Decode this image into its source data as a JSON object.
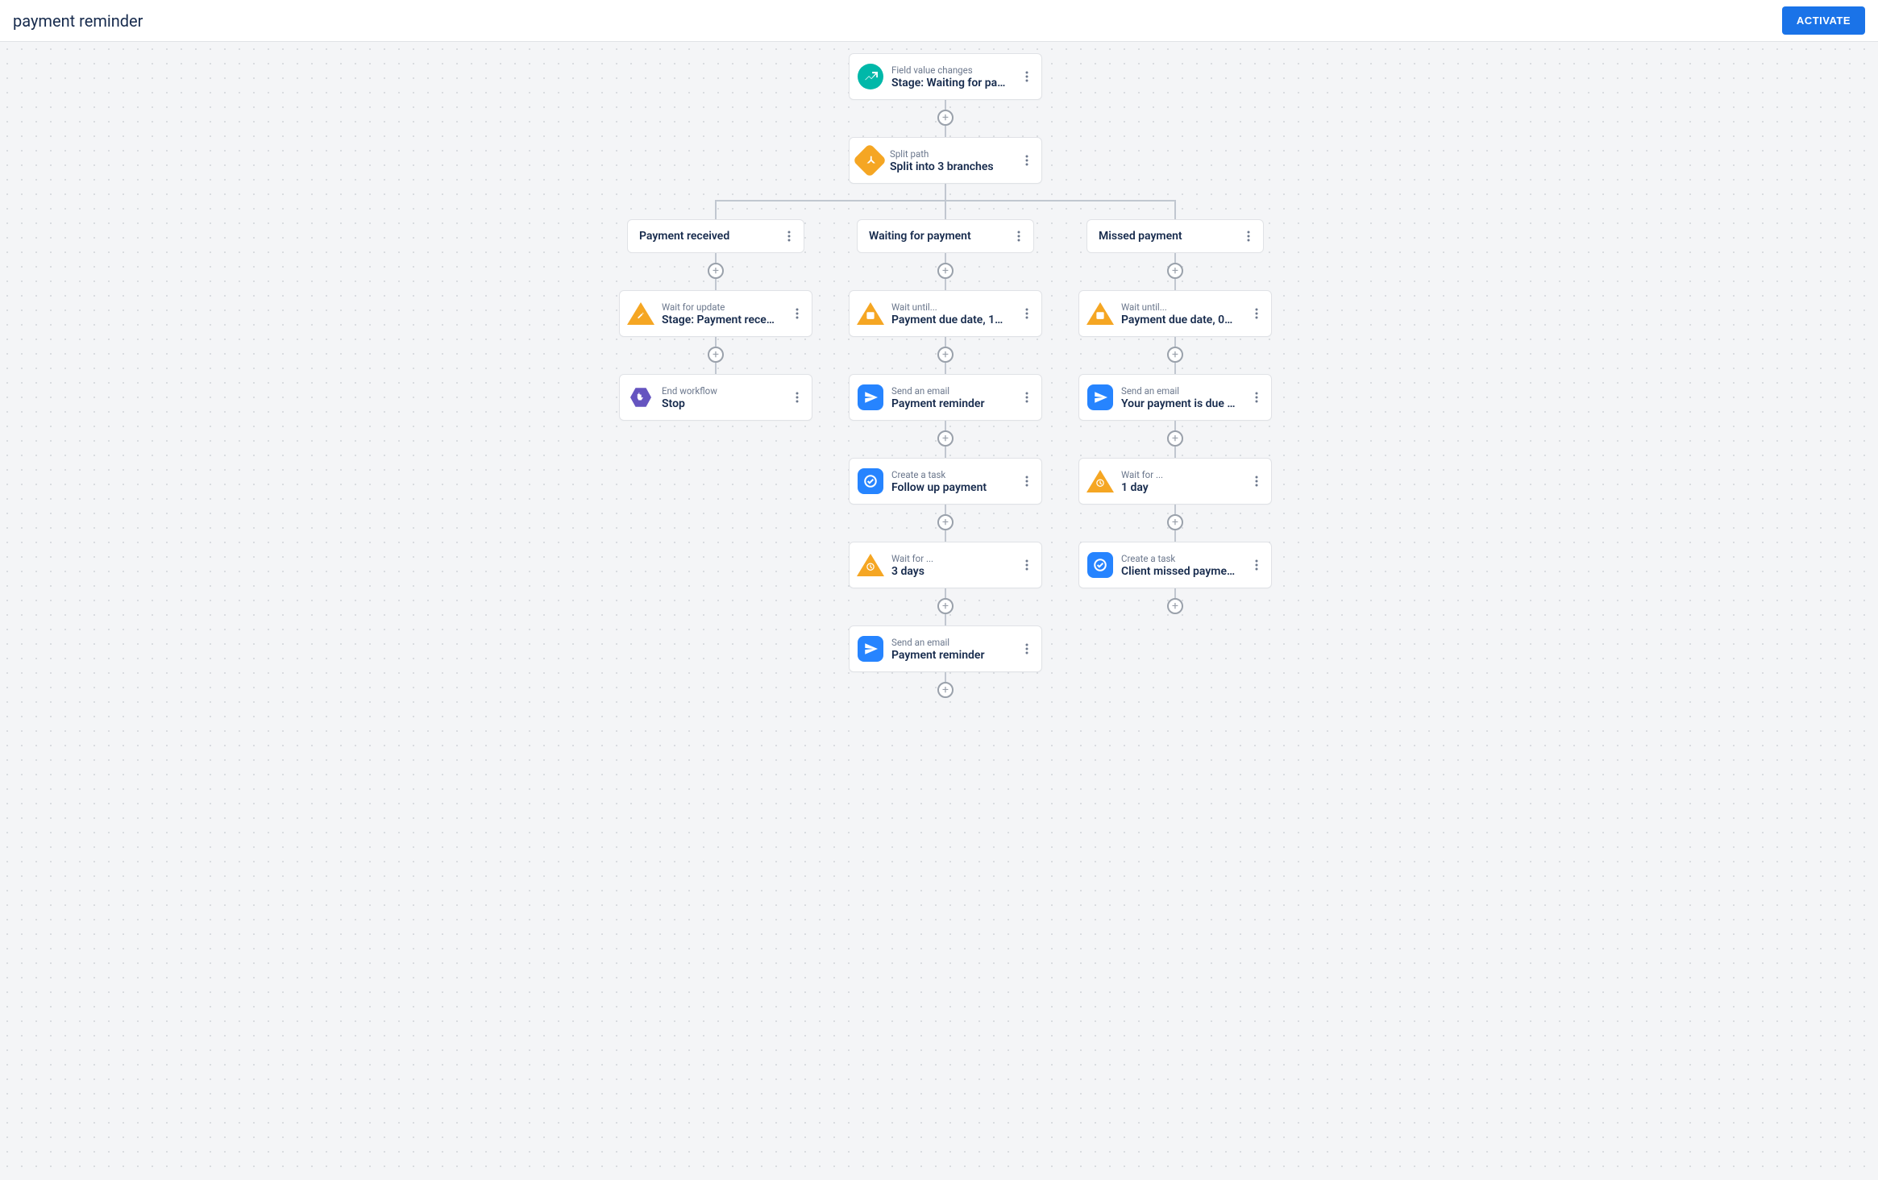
{
  "header": {
    "title": "payment reminder",
    "activate_label": "ACTIVATE"
  },
  "colors": {
    "accent_teal": "#00b8a9",
    "accent_orange": "#f5a623",
    "accent_blue": "#2684ff",
    "accent_purple": "#6554c0",
    "primary": "#1a73e8"
  },
  "nodes": {
    "trigger": {
      "subtitle": "Field value changes",
      "title": "Stage: Waiting for pa…",
      "icon": "trend-icon"
    },
    "split": {
      "subtitle": "Split path",
      "title": "Split into 3 branches",
      "icon": "split-icon"
    }
  },
  "branches": [
    {
      "label": "Payment received",
      "steps": [
        {
          "subtitle": "Wait for update",
          "title": "Stage: Payment rece…",
          "icon": "edit-triangle-icon"
        },
        {
          "subtitle": "End workflow",
          "title": "Stop",
          "icon": "stop-hex-icon"
        }
      ]
    },
    {
      "label": "Waiting for payment",
      "steps": [
        {
          "subtitle": "Wait until...",
          "title": "Payment due date, 1…",
          "icon": "calendar-triangle-icon"
        },
        {
          "subtitle": "Send an email",
          "title": "Payment reminder",
          "icon": "send-icon"
        },
        {
          "subtitle": "Create a task",
          "title": "Follow up payment",
          "icon": "task-icon"
        },
        {
          "subtitle": "Wait for ...",
          "title": "3 days",
          "icon": "clock-triangle-icon"
        },
        {
          "subtitle": "Send an email",
          "title": "Payment reminder",
          "icon": "send-icon"
        }
      ]
    },
    {
      "label": "Missed payment",
      "steps": [
        {
          "subtitle": "Wait until...",
          "title": "Payment due date, 0…",
          "icon": "calendar-triangle-icon"
        },
        {
          "subtitle": "Send an email",
          "title": "Your payment is due …",
          "icon": "send-icon"
        },
        {
          "subtitle": "Wait for ...",
          "title": "1 day",
          "icon": "clock-triangle-icon"
        },
        {
          "subtitle": "Create a task",
          "title": "Client missed payme…",
          "icon": "task-icon"
        }
      ]
    }
  ]
}
